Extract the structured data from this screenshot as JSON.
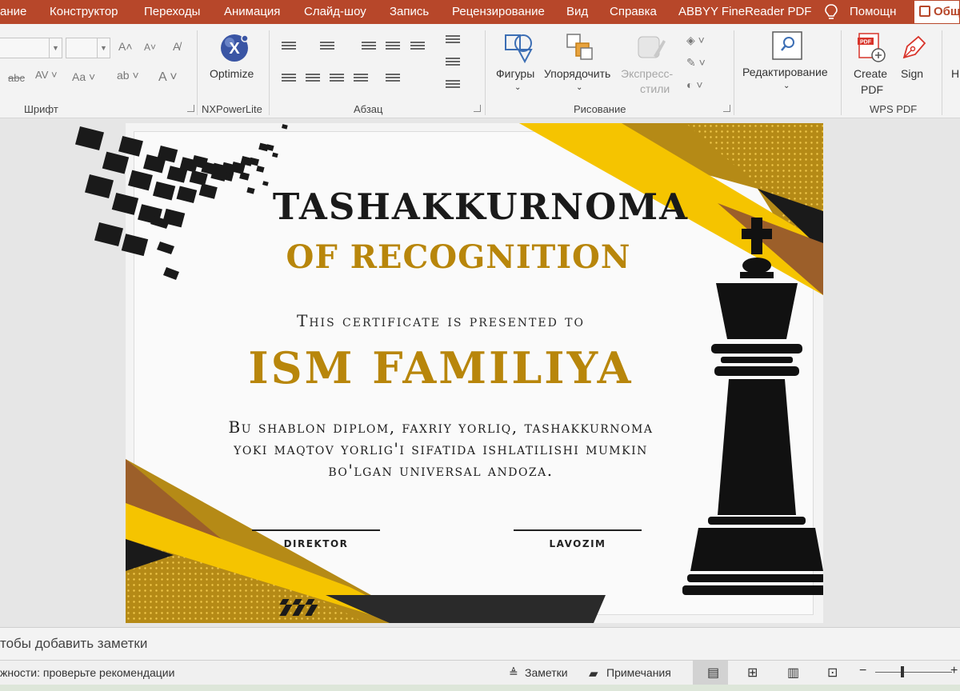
{
  "menubar": {
    "tabs": [
      "ание",
      "Конструктор",
      "Переходы",
      "Анимация",
      "Слайд-шоу",
      "Запись",
      "Рецензирование",
      "Вид",
      "Справка",
      "ABBYY FineReader PDF",
      "Помощн"
    ],
    "share_label": "Общ",
    "accent": "#b7472a"
  },
  "ribbon": {
    "groups": {
      "font": "Шрифт",
      "nxpowerlite": "NXPowerLite",
      "paragraph": "Абзац",
      "drawing": "Рисование",
      "wps": "WPS PDF"
    },
    "buttons": {
      "optimize": "Optimize",
      "shapes": "Фигуры",
      "arrange": "Упорядочить",
      "quick_styles_1": "Экспресс-",
      "quick_styles_2": "стили",
      "editing": "Редактирование",
      "create_pdf_1": "Create",
      "create_pdf_2": "PDF",
      "sign": "Sign",
      "more": "H"
    }
  },
  "slide": {
    "title": "TASHAKKURNOMA",
    "subtitle": "OF RECOGNITION",
    "presented": "This certificate is presented to",
    "name": "ISM FAMILIYA",
    "description_lines": [
      "Bu shablon diplom, faxriy yorliq, tashakkurnoma",
      "yoki maqtov yorlig'i sifatida ishlatilishi mumkin",
      "bo'lgan universal andoza."
    ],
    "signature_left": "DIREKTOR",
    "signature_right": "LAVOZIM",
    "colors": {
      "gold": "#b8860b",
      "yellow": "#f5c400",
      "brown": "#9c5f2a",
      "dark": "#1a1a1a"
    }
  },
  "notes": {
    "placeholder": "тобы добавить заметки"
  },
  "status": {
    "accessibility": "жности: проверьте рекомендации",
    "notes_label": "Заметки",
    "comments_label": "Примечания"
  }
}
